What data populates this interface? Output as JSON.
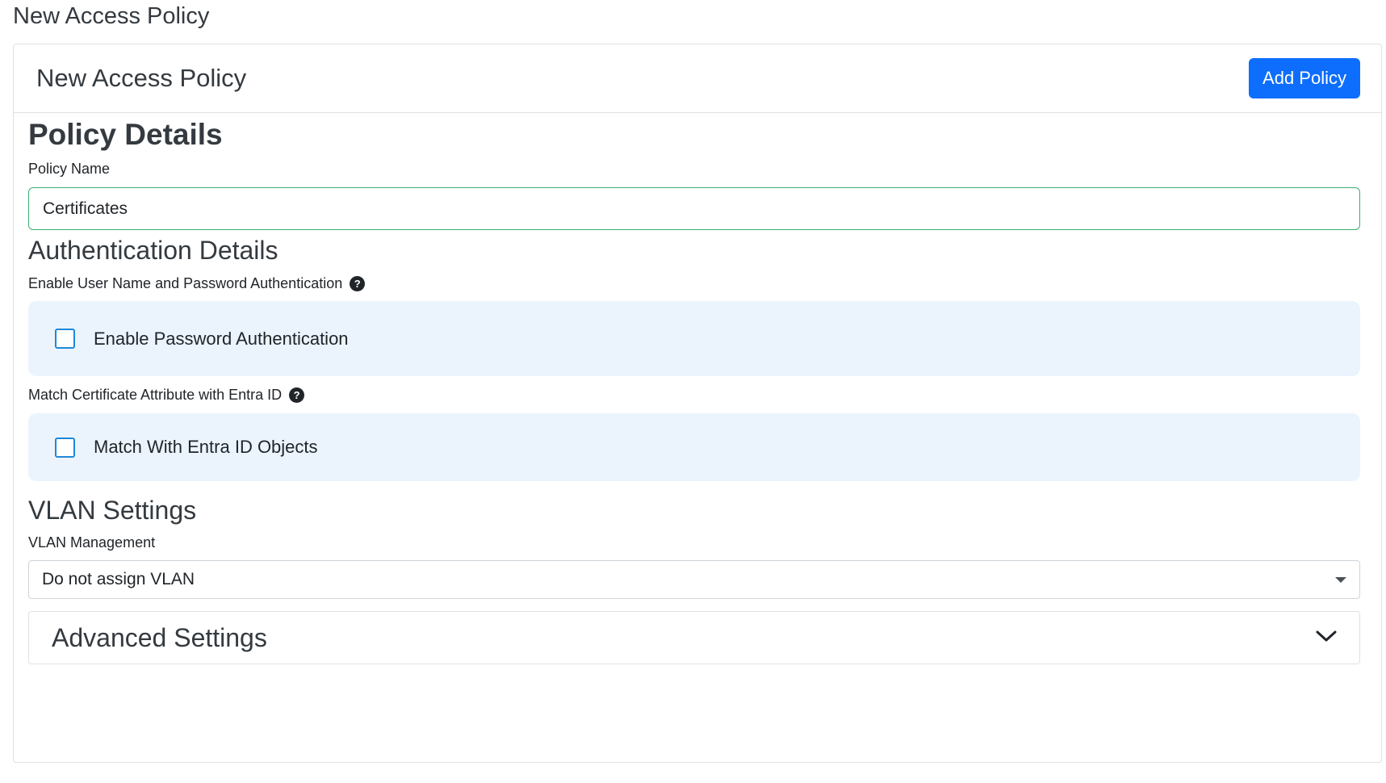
{
  "page": {
    "title": "New Access Policy"
  },
  "card": {
    "title": "New Access Policy",
    "add_button_label": "Add Policy"
  },
  "policy_details": {
    "heading": "Policy Details",
    "policy_name_label": "Policy Name",
    "policy_name_value": "Certificates"
  },
  "authentication": {
    "heading": "Authentication Details",
    "password_label": "Enable User Name and Password Authentication",
    "password_checkbox_label": "Enable Password Authentication",
    "password_checked": false,
    "entra_label": "Match Certificate Attribute with Entra ID",
    "entra_checkbox_label": "Match With Entra ID Objects",
    "entra_checked": false
  },
  "vlan": {
    "heading": "VLAN Settings",
    "management_label": "VLAN Management",
    "selected_option": "Do not assign VLAN"
  },
  "advanced": {
    "title": "Advanced Settings"
  },
  "help_icon_glyph": "?",
  "colors": {
    "primary": "#0d6efd",
    "input_focus_border": "#3cae6e",
    "panel_background": "#ebf4fd",
    "checkbox_border": "#1e88d9"
  }
}
